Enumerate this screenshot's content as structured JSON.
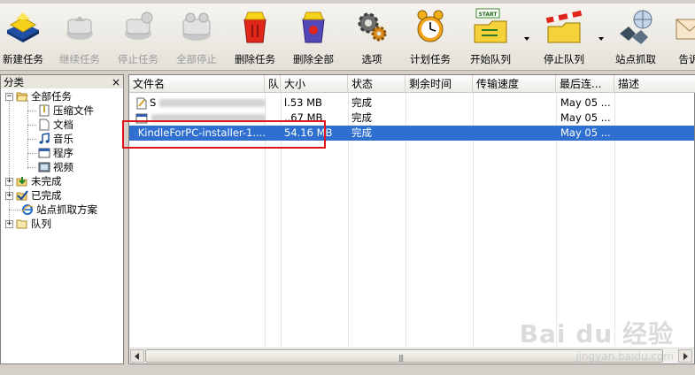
{
  "toolbar": {
    "buttons": [
      {
        "label": "新建任务",
        "icon": "new-task-icon",
        "enabled": true
      },
      {
        "label": "继续任务",
        "icon": "resume-task-icon",
        "enabled": false
      },
      {
        "label": "停止任务",
        "icon": "stop-task-icon",
        "enabled": false
      },
      {
        "label": "全部停止",
        "icon": "stop-all-icon",
        "enabled": false
      },
      {
        "label": "删除任务",
        "icon": "delete-task-icon",
        "enabled": true
      },
      {
        "label": "删除全部",
        "icon": "delete-all-icon",
        "enabled": true
      },
      {
        "label": "选项",
        "icon": "options-gear-icon",
        "enabled": true
      },
      {
        "label": "计划任务",
        "icon": "alarm-clock-icon",
        "enabled": true
      },
      {
        "label": "开始队列",
        "icon": "start-queue-icon",
        "enabled": true
      },
      {
        "label": "停止队列",
        "icon": "stop-queue-icon",
        "enabled": true
      },
      {
        "label": "站点抓取",
        "icon": "site-grabber-icon",
        "enabled": true
      },
      {
        "label": "告诉",
        "icon": "tell-friend-icon",
        "enabled": true
      }
    ],
    "start_badge": "START"
  },
  "tree": {
    "header": "分类",
    "close": "×",
    "items": [
      {
        "label": "全部任务",
        "icon": "folder-open-icon",
        "expander": "−"
      },
      {
        "label": "压缩文件",
        "icon": "zip-file-icon"
      },
      {
        "label": "文档",
        "icon": "document-icon"
      },
      {
        "label": "音乐",
        "icon": "music-note-icon"
      },
      {
        "label": "程序",
        "icon": "program-window-icon"
      },
      {
        "label": "视频",
        "icon": "video-film-icon"
      },
      {
        "label": "未完成",
        "icon": "download-arrow-icon",
        "expander": "+"
      },
      {
        "label": "已完成",
        "icon": "checkmark-icon",
        "expander": "+"
      },
      {
        "label": "站点抓取方案",
        "icon": "ie-icon"
      },
      {
        "label": "队列",
        "icon": "queue-folder-icon",
        "expander": "+"
      }
    ]
  },
  "list": {
    "columns": [
      "文件名",
      "队",
      "大小",
      "状态",
      "剩余时间",
      "传输速度",
      "最后连...",
      "描述"
    ],
    "rows": [
      {
        "name": "S",
        "icon": "document-edit-icon",
        "size": "l.53 MB",
        "status": "完成",
        "remaining": "",
        "speed": "",
        "last": "May 05 ...",
        "desc": "",
        "selected": false
      },
      {
        "name": "",
        "icon": "program-window-icon",
        "size": "..67 MB",
        "status": "完成",
        "remaining": "",
        "speed": "",
        "last": "May 05 ...",
        "desc": "",
        "selected": false
      },
      {
        "name": "KindleForPC-installer-1....",
        "icon": "program-window-icon",
        "size": "54.16 MB",
        "status": "完成",
        "remaining": "",
        "speed": "",
        "last": "May 05 ...",
        "desc": "",
        "selected": true
      }
    ]
  },
  "scrollbar": {
    "grip": "|||"
  },
  "watermark": {
    "main": "Bai du 经验",
    "sub": "jingyan.baidu.com"
  },
  "colors": {
    "selection": "#2f6fcf",
    "highlight": "#e0141b"
  }
}
